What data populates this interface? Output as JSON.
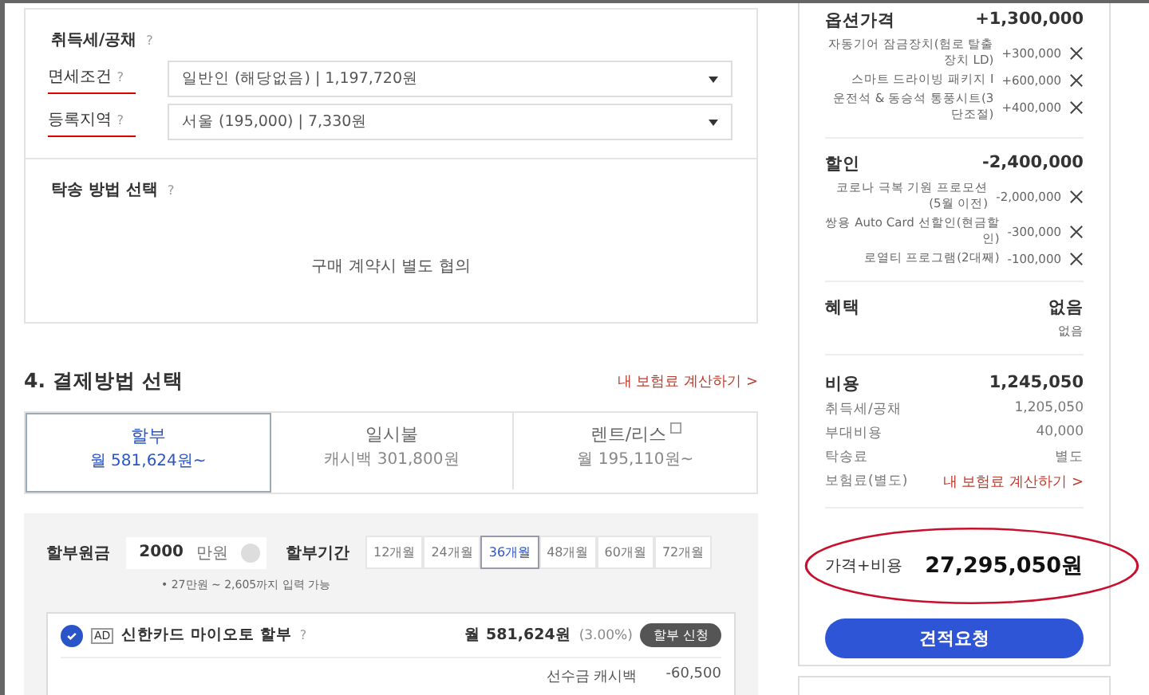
{
  "tax_card": {
    "title": "취득세/공채",
    "help": "?",
    "rows": [
      {
        "label": "면세조건",
        "help": "?",
        "value": "일반인 (해당없음) | 1,197,720원",
        "underlined": true
      },
      {
        "label": "등록지역",
        "help": "?",
        "value": "서울 (195,000) | 7,330원",
        "underlined": true
      }
    ],
    "delivery_title": "탁송 방법 선택",
    "delivery_help": "?",
    "delivery_text": "구매 계약시 별도 협의"
  },
  "payment": {
    "title": "4. 결제방법 선택",
    "insurance_link": "내 보험료 계산하기 >",
    "tabs": [
      {
        "label": "할부",
        "sub": "월 581,624원~",
        "selected": true,
        "info": false
      },
      {
        "label": "일시불",
        "sub": "캐시백 301,800원",
        "selected": false,
        "info": false
      },
      {
        "label": "렌트/리스",
        "sub": "월 195,110원~",
        "selected": false,
        "info": true
      }
    ],
    "principal_label": "할부원금",
    "principal_value": "2000",
    "principal_unit": "만원",
    "principal_note": "• 27만원 ~ 2,605까지 입력 가능",
    "period_label": "할부기간",
    "periods": [
      {
        "label": "12개월",
        "selected": false
      },
      {
        "label": "24개월",
        "selected": false
      },
      {
        "label": "36개월",
        "selected": true
      },
      {
        "label": "48개월",
        "selected": false
      },
      {
        "label": "60개월",
        "selected": false
      },
      {
        "label": "72개월",
        "selected": false
      }
    ],
    "offer": {
      "checked": true,
      "badge": "AD",
      "name": "신한카드 마이오토 할부",
      "help": "?",
      "monthly": "월 581,624원",
      "rate": "(3.00%)",
      "apply": "할부 신청",
      "lines": [
        {
          "label": "선수금 캐시백",
          "amount": "-60,500"
        }
      ]
    }
  },
  "summary": {
    "groups": [
      {
        "title": "옵션가격",
        "total": "+1,300,000",
        "items": [
          {
            "name": "자동기어 잠금장치(험로 탈출장치 LD)",
            "amount": "+300,000",
            "removable": true
          },
          {
            "name": "스마트 드라이빙 패키지 I",
            "amount": "+600,000",
            "removable": true
          },
          {
            "name": "운전석 & 동승석 통풍시트(3단조절)",
            "amount": "+400,000",
            "removable": true
          }
        ]
      },
      {
        "title": "할인",
        "total": "-2,400,000",
        "items": [
          {
            "name": "코로나 극복 기원 프로모션(5월 이전)",
            "amount": "-2,000,000",
            "removable": true
          },
          {
            "name": "쌍용 Auto Card 선할인(현금할인)",
            "amount": "-300,000",
            "removable": true
          },
          {
            "name": "로열티 프로그램(2대째)",
            "amount": "-100,000",
            "removable": true
          }
        ]
      },
      {
        "title": "혜택",
        "total": "없음",
        "items": [
          {
            "name": "없음",
            "removable": false
          }
        ]
      }
    ],
    "cost": {
      "title": "비용",
      "total": "1,245,050",
      "rows": [
        {
          "label": "취득세/공채",
          "value": "1,205,050",
          "kind": "plain"
        },
        {
          "label": "부대비용",
          "value": "40,000",
          "kind": "plain"
        },
        {
          "label": "탁송료",
          "value": "별도",
          "kind": "plain"
        },
        {
          "label": "보험료(별도)",
          "value": "내 보험료 계산하기 >",
          "kind": "link"
        }
      ]
    },
    "grand_label": "가격+비용",
    "grand_total": "27,295,050원",
    "grand_circled": true,
    "quote_button": "견적요청"
  }
}
